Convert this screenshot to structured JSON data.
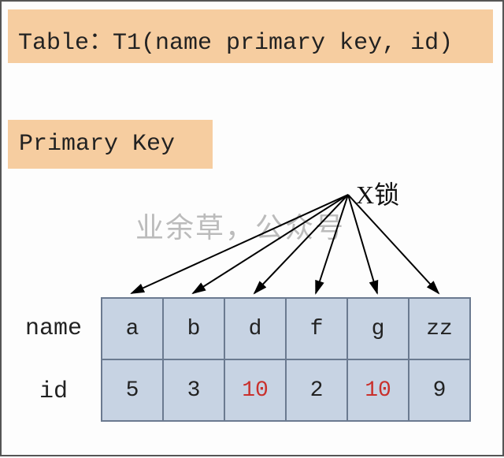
{
  "title": "Table：T1(name primary key, id)",
  "primaryKeyLabel": "Primary Key",
  "lockLabel": "X锁",
  "watermark": "业余草，公众号",
  "rowLabels": {
    "name": "name",
    "id": "id"
  },
  "columns": [
    {
      "name": "a",
      "id": "5",
      "idHighlight": false
    },
    {
      "name": "b",
      "id": "3",
      "idHighlight": false
    },
    {
      "name": "d",
      "id": "10",
      "idHighlight": true
    },
    {
      "name": "f",
      "id": "2",
      "idHighlight": false
    },
    {
      "name": "g",
      "id": "10",
      "idHighlight": true
    },
    {
      "name": "zz",
      "id": "9",
      "idHighlight": false
    }
  ],
  "chart_data": {
    "type": "table",
    "title": "T1(name primary key, id)",
    "primary_key": "name",
    "lock_type": "X锁",
    "columns": [
      "name",
      "id"
    ],
    "rows": [
      {
        "name": "a",
        "id": 5
      },
      {
        "name": "b",
        "id": 3
      },
      {
        "name": "d",
        "id": 10
      },
      {
        "name": "f",
        "id": 2
      },
      {
        "name": "g",
        "id": 10
      },
      {
        "name": "zz",
        "id": 9
      }
    ],
    "highlighted_id_value": 10,
    "arrows": "X锁 label points to every column header cell"
  }
}
